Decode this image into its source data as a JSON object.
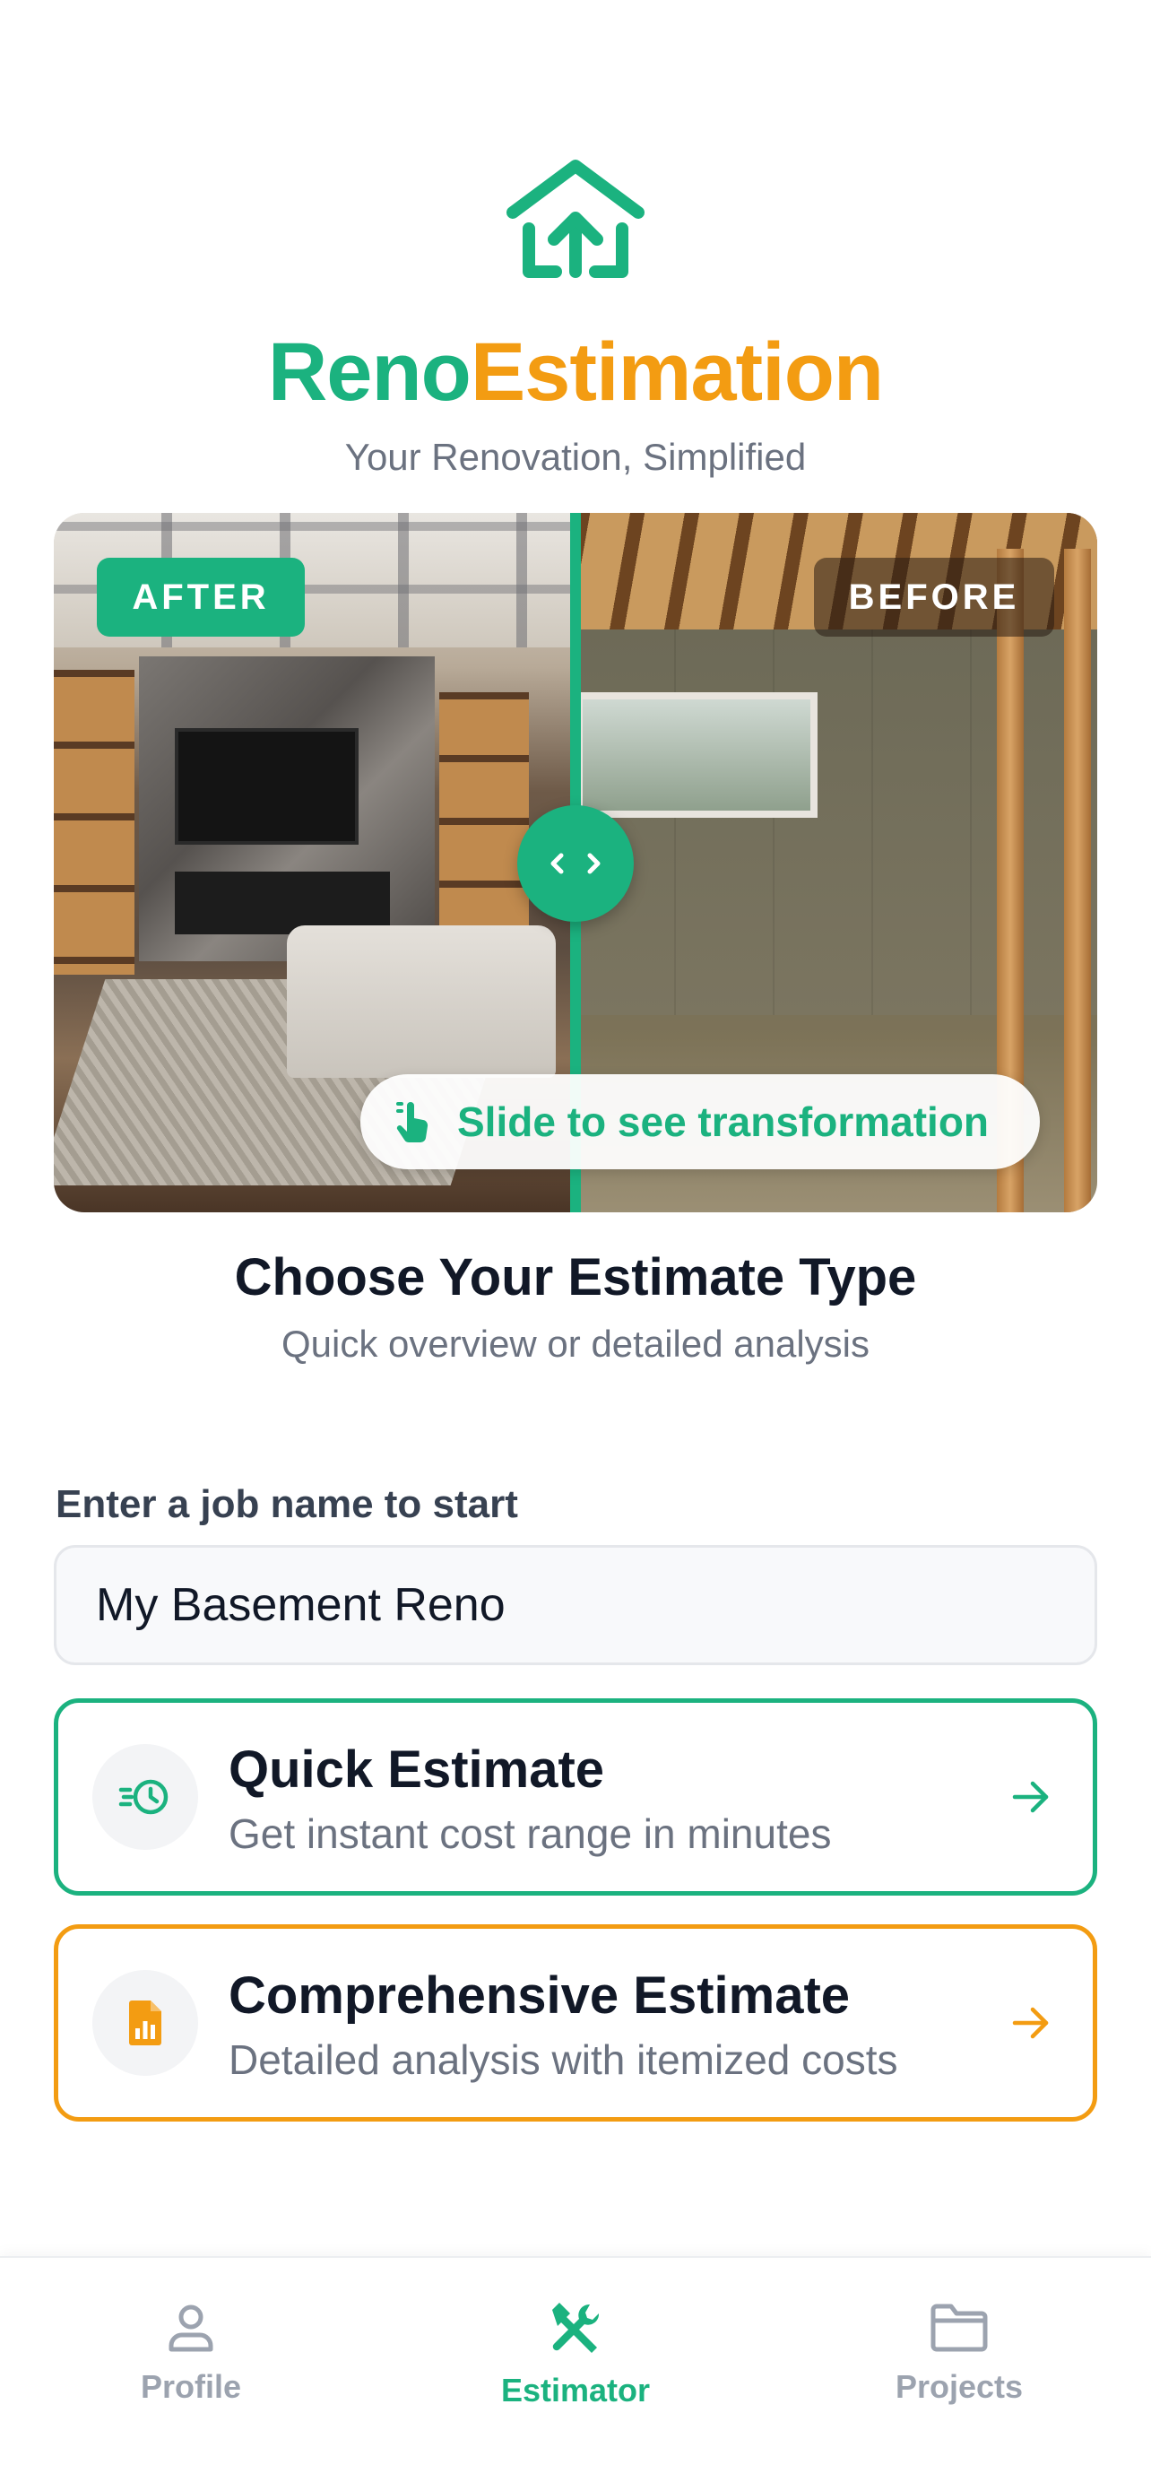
{
  "brand": {
    "name_part1": "Reno",
    "name_part2": "Estimation",
    "tagline": "Your Renovation, Simplified",
    "colors": {
      "primary": "#1bb27f",
      "accent": "#f39c12"
    },
    "logo_icon": "house-upload-icon"
  },
  "comparison": {
    "after_label": "AFTER",
    "before_label": "BEFORE",
    "handle_icon": "chevron-left-right-icon",
    "hint_icon": "swipe-hand-icon",
    "hint_text": "Slide to see transformation"
  },
  "section": {
    "title": "Choose Your Estimate Type",
    "subtitle": "Quick overview or detailed analysis"
  },
  "job": {
    "label": "Enter a job name to start",
    "value": "My Basement Reno"
  },
  "options": {
    "quick": {
      "title": "Quick Estimate",
      "description": "Get instant cost range in minutes",
      "icon": "fast-clock-icon"
    },
    "comprehensive": {
      "title": "Comprehensive Estimate",
      "description": "Detailed analysis with itemized costs",
      "icon": "report-chart-icon"
    }
  },
  "nav": {
    "profile": "Profile",
    "estimator": "Estimator",
    "projects": "Projects",
    "active": "Estimator"
  }
}
